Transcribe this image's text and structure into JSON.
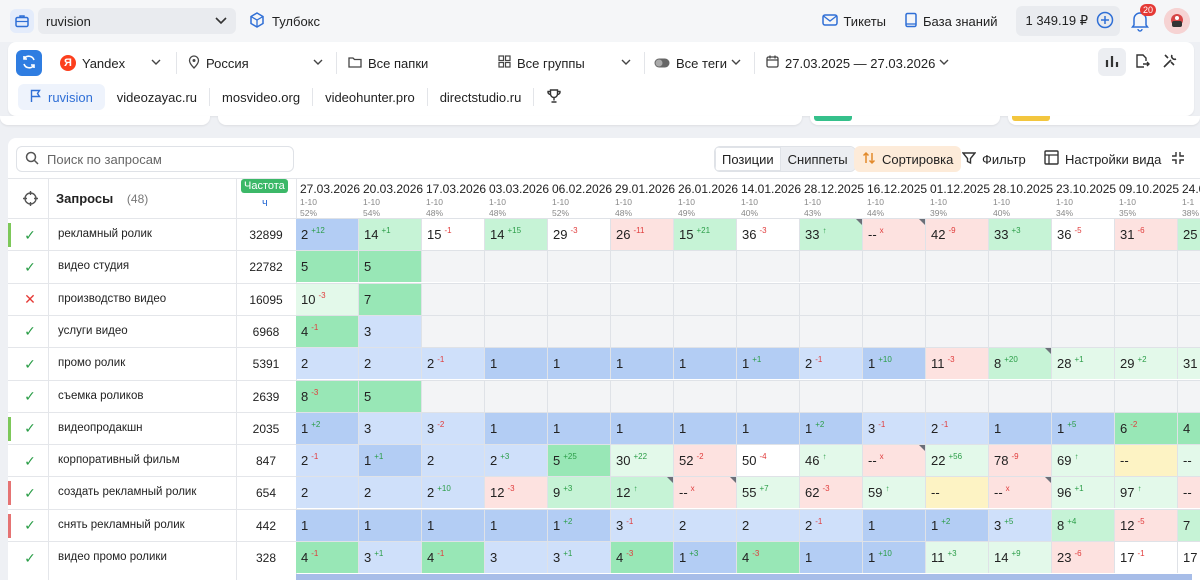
{
  "topbar": {
    "project": "ruvision",
    "toolbox": "Тулбокс",
    "tickets": "Тикеты",
    "knowledge": "База знаний",
    "balance": "1 349.19 ₽",
    "notifications": "20"
  },
  "filters": {
    "engine": "Yandex",
    "region": "Россия",
    "folders": "Все папки",
    "groups": "Все группы",
    "tags": "Все теги",
    "dates": "27.03.2025 — 27.03.2026"
  },
  "project_tabs": [
    "ruvision",
    "videozayac.ru",
    "mosvideo.org",
    "videohunter.pro",
    "directstudio.ru"
  ],
  "toolbar": {
    "search_placeholder": "Поиск по запросам",
    "positions": "Позиции",
    "snippets": "Сниппеты",
    "sort": "Сортировка",
    "filter": "Фильтр",
    "view_settings": "Настройки вида"
  },
  "table": {
    "queries_label": "Запросы",
    "queries_count": "(48)",
    "freq_label": "Частота",
    "freq_sub": "ч",
    "dates": [
      {
        "d": "27.03.2026",
        "r": "1-10",
        "p": "52%"
      },
      {
        "d": "20.03.2026",
        "r": "1-10",
        "p": "54%"
      },
      {
        "d": "17.03.2026",
        "r": "1-10",
        "p": "48%"
      },
      {
        "d": "03.03.2026",
        "r": "1-10",
        "p": "48%"
      },
      {
        "d": "06.02.2026",
        "r": "1-10",
        "p": "52%"
      },
      {
        "d": "29.01.2026",
        "r": "1-10",
        "p": "48%"
      },
      {
        "d": "26.01.2026",
        "r": "1-10",
        "p": "49%"
      },
      {
        "d": "14.01.2026",
        "r": "1-10",
        "p": "40%"
      },
      {
        "d": "28.12.2025",
        "r": "1-10",
        "p": "43%"
      },
      {
        "d": "16.12.2025",
        "r": "1-10",
        "p": "44%"
      },
      {
        "d": "01.12.2025",
        "r": "1-10",
        "p": "39%"
      },
      {
        "d": "28.10.2025",
        "r": "1-10",
        "p": "40%"
      },
      {
        "d": "23.10.2025",
        "r": "1-10",
        "p": "34%"
      },
      {
        "d": "09.10.2025",
        "r": "1-10",
        "p": "35%"
      },
      {
        "d": "24.0",
        "r": "1-1",
        "p": "38%"
      }
    ],
    "rows": [
      {
        "q": "рекламный ролик",
        "f": "32899",
        "s": "ok",
        "m": "#7dc85a",
        "c": [
          [
            "2",
            "12",
            "up",
            "b2"
          ],
          [
            "14",
            "1",
            "up",
            "g2"
          ],
          [
            "15",
            "1",
            "dn",
            "w"
          ],
          [
            "14",
            "15",
            "up",
            "g2"
          ],
          [
            "29",
            "3",
            "dn",
            "w"
          ],
          [
            "26",
            "11",
            "dn",
            "r"
          ],
          [
            "15",
            "21",
            "up",
            "g2"
          ],
          [
            "36",
            "3",
            "dn",
            "w"
          ],
          [
            "33",
            "↑",
            "up",
            "g2"
          ],
          [
            "--",
            "x",
            "dn",
            "r"
          ],
          [
            "42",
            "9",
            "dn",
            "r"
          ],
          [
            "33",
            "3",
            "up",
            "g2"
          ],
          [
            "36",
            "5",
            "dn",
            "w"
          ],
          [
            "31",
            "6",
            "dn",
            "r"
          ],
          [
            "25",
            "",
            "",
            "g2"
          ]
        ]
      },
      {
        "q": "видео студия",
        "f": "22782",
        "s": "ok",
        "m": "",
        "c": [
          [
            "5",
            "",
            "",
            "g3"
          ],
          [
            "5",
            "",
            "",
            "g3"
          ],
          [
            "",
            "",
            "",
            "e"
          ],
          [
            "",
            "",
            "",
            "e"
          ],
          [
            "",
            "",
            "",
            "e"
          ],
          [
            "",
            "",
            "",
            "e"
          ],
          [
            "",
            "",
            "",
            "e"
          ],
          [
            "",
            "",
            "",
            "e"
          ],
          [
            "",
            "",
            "",
            "e"
          ],
          [
            "",
            "",
            "",
            "e"
          ],
          [
            "",
            "",
            "",
            "e"
          ],
          [
            "",
            "",
            "",
            "e"
          ],
          [
            "",
            "",
            "",
            "e"
          ],
          [
            "",
            "",
            "",
            "e"
          ],
          [
            "",
            "",
            "",
            "e"
          ]
        ]
      },
      {
        "q": "производство видео",
        "f": "16095",
        "s": "x",
        "m": "",
        "c": [
          [
            "10",
            "3",
            "dn",
            "g1"
          ],
          [
            "7",
            "",
            "",
            "g3"
          ],
          [
            "",
            "",
            "",
            "e"
          ],
          [
            "",
            "",
            "",
            "e"
          ],
          [
            "",
            "",
            "",
            "e"
          ],
          [
            "",
            "",
            "",
            "e"
          ],
          [
            "",
            "",
            "",
            "e"
          ],
          [
            "",
            "",
            "",
            "e"
          ],
          [
            "",
            "",
            "",
            "e"
          ],
          [
            "",
            "",
            "",
            "e"
          ],
          [
            "",
            "",
            "",
            "e"
          ],
          [
            "",
            "",
            "",
            "e"
          ],
          [
            "",
            "",
            "",
            "e"
          ],
          [
            "",
            "",
            "",
            "e"
          ],
          [
            "",
            "",
            "",
            "e"
          ]
        ]
      },
      {
        "q": "услуги видео",
        "f": "6968",
        "s": "ok",
        "m": "",
        "c": [
          [
            "4",
            "1",
            "dn",
            "g3"
          ],
          [
            "3",
            "",
            "",
            "b1"
          ],
          [
            "",
            "",
            "",
            "e"
          ],
          [
            "",
            "",
            "",
            "e"
          ],
          [
            "",
            "",
            "",
            "e"
          ],
          [
            "",
            "",
            "",
            "e"
          ],
          [
            "",
            "",
            "",
            "e"
          ],
          [
            "",
            "",
            "",
            "e"
          ],
          [
            "",
            "",
            "",
            "e"
          ],
          [
            "",
            "",
            "",
            "e"
          ],
          [
            "",
            "",
            "",
            "e"
          ],
          [
            "",
            "",
            "",
            "e"
          ],
          [
            "",
            "",
            "",
            "e"
          ],
          [
            "",
            "",
            "",
            "e"
          ],
          [
            "",
            "",
            "",
            "e"
          ]
        ]
      },
      {
        "q": "промо ролик",
        "f": "5391",
        "s": "ok",
        "m": "",
        "c": [
          [
            "2",
            "",
            "",
            "b1"
          ],
          [
            "2",
            "",
            "",
            "b1"
          ],
          [
            "2",
            "1",
            "dn",
            "b1"
          ],
          [
            "1",
            "",
            "",
            "b2"
          ],
          [
            "1",
            "",
            "",
            "b2"
          ],
          [
            "1",
            "",
            "",
            "b2"
          ],
          [
            "1",
            "",
            "",
            "b2"
          ],
          [
            "1",
            "1",
            "up",
            "b2"
          ],
          [
            "2",
            "1",
            "dn",
            "b1"
          ],
          [
            "1",
            "10",
            "up",
            "b2"
          ],
          [
            "11",
            "3",
            "dn",
            "r"
          ],
          [
            "8",
            "20",
            "up",
            "g2c"
          ],
          [
            "28",
            "1",
            "up",
            "g1"
          ],
          [
            "29",
            "2",
            "up",
            "g1"
          ],
          [
            "31",
            "",
            "",
            "g1"
          ]
        ]
      },
      {
        "q": "съемка роликов",
        "f": "2639",
        "s": "ok",
        "m": "",
        "c": [
          [
            "8",
            "3",
            "dn",
            "g3"
          ],
          [
            "5",
            "",
            "",
            "g3"
          ],
          [
            "",
            "",
            "",
            "e"
          ],
          [
            "",
            "",
            "",
            "e"
          ],
          [
            "",
            "",
            "",
            "e"
          ],
          [
            "",
            "",
            "",
            "e"
          ],
          [
            "",
            "",
            "",
            "e"
          ],
          [
            "",
            "",
            "",
            "e"
          ],
          [
            "",
            "",
            "",
            "e"
          ],
          [
            "",
            "",
            "",
            "e"
          ],
          [
            "",
            "",
            "",
            "e"
          ],
          [
            "",
            "",
            "",
            "e"
          ],
          [
            "",
            "",
            "",
            "e"
          ],
          [
            "",
            "",
            "",
            "e"
          ],
          [
            "",
            "",
            "",
            "e"
          ]
        ]
      },
      {
        "q": "видеопродакшн",
        "f": "2035",
        "s": "ok",
        "m": "#7dc85a",
        "c": [
          [
            "1",
            "2",
            "up",
            "b2"
          ],
          [
            "3",
            "",
            "",
            "b1"
          ],
          [
            "3",
            "2",
            "dn",
            "b1"
          ],
          [
            "1",
            "",
            "",
            "b2"
          ],
          [
            "1",
            "",
            "",
            "b2"
          ],
          [
            "1",
            "",
            "",
            "b2"
          ],
          [
            "1",
            "",
            "",
            "b2"
          ],
          [
            "1",
            "",
            "",
            "b2"
          ],
          [
            "1",
            "2",
            "up",
            "b2"
          ],
          [
            "3",
            "1",
            "dn",
            "b1"
          ],
          [
            "2",
            "1",
            "dn",
            "b1"
          ],
          [
            "1",
            "",
            "",
            "b2"
          ],
          [
            "1",
            "5",
            "up",
            "b2"
          ],
          [
            "6",
            "2",
            "dn",
            "g3"
          ],
          [
            "4",
            "",
            "",
            "g3"
          ]
        ]
      },
      {
        "q": "корпоративный фильм",
        "f": "847",
        "s": "ok",
        "m": "",
        "c": [
          [
            "2",
            "1",
            "dn",
            "b1"
          ],
          [
            "1",
            "1",
            "up",
            "b2"
          ],
          [
            "2",
            "",
            "",
            "b1"
          ],
          [
            "2",
            "3",
            "up",
            "b1"
          ],
          [
            "5",
            "25",
            "up",
            "g3"
          ],
          [
            "30",
            "22",
            "up",
            "g1"
          ],
          [
            "52",
            "2",
            "dn",
            "r"
          ],
          [
            "50",
            "4",
            "dn",
            "w"
          ],
          [
            "46",
            "↑",
            "up",
            "g1"
          ],
          [
            "--",
            "x",
            "dn",
            "r"
          ],
          [
            "22",
            "56",
            "up",
            "g1"
          ],
          [
            "78",
            "9",
            "dn",
            "r"
          ],
          [
            "69",
            "↑",
            "up",
            "g1"
          ],
          [
            "--",
            "",
            "",
            "y"
          ],
          [
            "--",
            "",
            "",
            "g1"
          ]
        ]
      },
      {
        "q": "создать рекламный ролик",
        "f": "654",
        "s": "ok",
        "m": "#e57373",
        "c": [
          [
            "2",
            "",
            "",
            "b1"
          ],
          [
            "2",
            "",
            "",
            "b1"
          ],
          [
            "2",
            "10",
            "up",
            "b1"
          ],
          [
            "12",
            "3",
            "dn",
            "r"
          ],
          [
            "9",
            "3",
            "up",
            "g2"
          ],
          [
            "12",
            "↑",
            "up",
            "g2"
          ],
          [
            "--",
            "x",
            "dn",
            "r"
          ],
          [
            "55",
            "7",
            "up",
            "g1"
          ],
          [
            "62",
            "3",
            "dn",
            "r"
          ],
          [
            "59",
            "↑",
            "up",
            "g1"
          ],
          [
            "--",
            "",
            "",
            "y"
          ],
          [
            "--",
            "x",
            "dn",
            "r"
          ],
          [
            "96",
            "1",
            "up",
            "g1"
          ],
          [
            "97",
            "↑",
            "up",
            "g1"
          ],
          [
            "--",
            "",
            "",
            "r"
          ]
        ]
      },
      {
        "q": "снять рекламный ролик",
        "f": "442",
        "s": "ok",
        "m": "#e57373",
        "c": [
          [
            "1",
            "",
            "",
            "b2"
          ],
          [
            "1",
            "",
            "",
            "b2"
          ],
          [
            "1",
            "",
            "",
            "b2"
          ],
          [
            "1",
            "",
            "",
            "b2"
          ],
          [
            "1",
            "2",
            "up",
            "b2"
          ],
          [
            "3",
            "1",
            "dn",
            "b1"
          ],
          [
            "2",
            "",
            "",
            "b1"
          ],
          [
            "2",
            "",
            "",
            "b1"
          ],
          [
            "2",
            "1",
            "dn",
            "b1"
          ],
          [
            "1",
            "",
            "",
            "b2"
          ],
          [
            "1",
            "2",
            "up",
            "b2"
          ],
          [
            "3",
            "5",
            "up",
            "b1"
          ],
          [
            "8",
            "4",
            "up",
            "g2"
          ],
          [
            "12",
            "5",
            "dn",
            "r"
          ],
          [
            "7",
            "",
            "",
            "g2"
          ]
        ]
      },
      {
        "q": "видео промо ролики",
        "f": "328",
        "s": "ok",
        "m": "",
        "c": [
          [
            "4",
            "1",
            "dn",
            "g3"
          ],
          [
            "3",
            "1",
            "up",
            "b1"
          ],
          [
            "4",
            "1",
            "dn",
            "g3"
          ],
          [
            "3",
            "",
            "",
            "b1"
          ],
          [
            "3",
            "1",
            "up",
            "b1"
          ],
          [
            "4",
            "3",
            "dn",
            "g3"
          ],
          [
            "1",
            "3",
            "up",
            "b2"
          ],
          [
            "4",
            "3",
            "dn",
            "g3"
          ],
          [
            "1",
            "",
            "",
            "b2"
          ],
          [
            "1",
            "10",
            "up",
            "b2"
          ],
          [
            "11",
            "3",
            "up",
            "g1"
          ],
          [
            "14",
            "9",
            "up",
            "g1"
          ],
          [
            "23",
            "6",
            "dn",
            "r"
          ],
          [
            "17",
            "1",
            "dn",
            "w"
          ],
          [
            "17",
            "",
            "",
            "w"
          ]
        ]
      }
    ]
  }
}
